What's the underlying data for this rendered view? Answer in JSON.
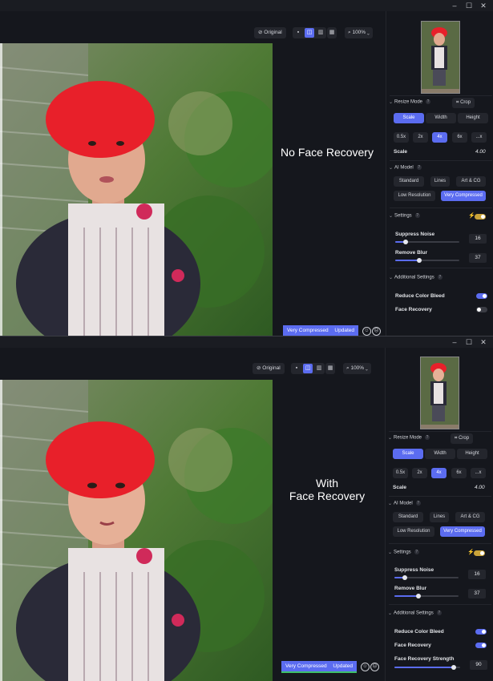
{
  "window_controls": {
    "minimize": "–",
    "maximize": "☐",
    "close": "✕"
  },
  "toolbar": {
    "original_label": "Original",
    "zoom_label": "100%",
    "zoom_arrow": "⌄"
  },
  "top": {
    "overlay": {
      "line1": "No Face Recovery",
      "line2": ""
    },
    "status": {
      "model": "Very Compressed",
      "state": "Updated"
    },
    "resize_mode": {
      "title": "Resize Mode",
      "crop": "Crop",
      "tabs": [
        "Scale",
        "Width",
        "Height"
      ],
      "scales": [
        "0.5x",
        "2x",
        "4x",
        "6x",
        "...x"
      ],
      "scale_label": "Scale",
      "scale_value": "4.00"
    },
    "ai_model": {
      "title": "AI Model",
      "models": [
        "Standard",
        "Lines",
        "Art & CG",
        "Low Resolution",
        "Very Compressed"
      ]
    },
    "settings": {
      "title": "Settings",
      "suppress_noise_label": "Suppress Noise",
      "suppress_noise_value": "16",
      "suppress_noise_fraction": 0.16,
      "remove_blur_label": "Remove Blur",
      "remove_blur_value": "37",
      "remove_blur_fraction": 0.37
    },
    "additional": {
      "title": "Additional Settings",
      "reduce_color_bleed": "Reduce Color Bleed",
      "face_recovery": "Face Recovery"
    }
  },
  "bottom": {
    "overlay": {
      "line1": "With",
      "line2": "Face Recovery"
    },
    "status": {
      "model": "Very Compressed",
      "state": "Updated"
    },
    "resize_mode": {
      "title": "Resize Mode",
      "crop": "Crop",
      "tabs": [
        "Scale",
        "Width",
        "Height"
      ],
      "scales": [
        "0.5x",
        "2x",
        "4x",
        "6x",
        "...x"
      ],
      "scale_label": "Scale",
      "scale_value": "4.00"
    },
    "ai_model": {
      "title": "AI Model",
      "models": [
        "Standard",
        "Lines",
        "Art & CG",
        "Low Resolution",
        "Very Compressed"
      ]
    },
    "settings": {
      "title": "Settings",
      "suppress_noise_label": "Suppress Noise",
      "suppress_noise_value": "16",
      "suppress_noise_fraction": 0.16,
      "remove_blur_label": "Remove Blur",
      "remove_blur_value": "37",
      "remove_blur_fraction": 0.37
    },
    "additional": {
      "title": "Additional Settings",
      "reduce_color_bleed": "Reduce Color Bleed",
      "face_recovery": "Face Recovery",
      "face_recovery_strength": "Face Recovery Strength",
      "face_recovery_strength_value": "90",
      "face_recovery_strength_fraction": 0.9
    }
  },
  "colors": {
    "accent": "#5b6cf0",
    "toggle_gold": "#c9a33a",
    "background": "#15171d"
  },
  "icons": {
    "original": "eye-slash-icon",
    "zoom": "magnifier-icon",
    "crop": "crop-icon",
    "bolt": "bolt-icon",
    "happy": "smile-icon",
    "sad": "frown-icon"
  }
}
